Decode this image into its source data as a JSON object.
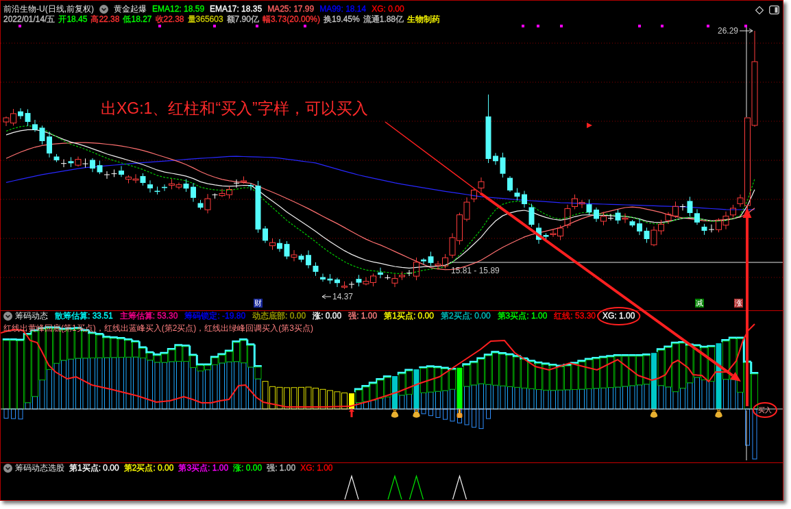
{
  "price_panel": {
    "title": "前沿生物-U(日线,前复权)",
    "formula": "黄金起爆",
    "indicators": [
      {
        "text": "EMA12: 18.59",
        "color": "#00ff00"
      },
      {
        "text": "EMA17: 18.35",
        "color": "#ffffff"
      },
      {
        "text": "MA25: 17.99",
        "color": "#ff6060"
      },
      {
        "text": "MA99: 18.14",
        "color": "#0000ff"
      },
      {
        "text": "XG: 0.00",
        "color": "#ff0000"
      }
    ],
    "quote": [
      {
        "text": "2022/01/14/五",
        "color": "#c0c0c0"
      },
      {
        "text": "开18.45",
        "color": "#00ff00"
      },
      {
        "text": "高22.38",
        "color": "#ff3232"
      },
      {
        "text": "低18.27",
        "color": "#00ff00"
      },
      {
        "text": "收22.38",
        "color": "#ff3232"
      },
      {
        "text": "量365603",
        "color": "#c8c800"
      },
      {
        "text": "额7.90亿",
        "color": "#c0c0c0"
      },
      {
        "text": "幅3.73(20.00%)",
        "color": "#ff3232"
      },
      {
        "text": "换19.45%",
        "color": "#c0c0c0"
      },
      {
        "text": "流通1.88亿",
        "color": "#c0c0c0"
      },
      {
        "text": "生物制药",
        "color": "#ffff00"
      }
    ],
    "high_label": "26.29",
    "range_label": "15.81 - 15.89",
    "low_label": "14.37",
    "event_markers": [
      {
        "text": "财",
        "color": "#1a2a9a"
      },
      {
        "text": "减",
        "color": "#008000"
      },
      {
        "text": "涨",
        "color": "#b03030"
      }
    ],
    "annotation": "出XG:1、红柱和“买入”字样，可以买入"
  },
  "chip_panel": {
    "title": "筹码动态",
    "values": [
      {
        "text": "散筹估算: 33.51",
        "color": "#00ffff"
      },
      {
        "text": "主筹估算: 53.30",
        "color": "#ff0090"
      },
      {
        "text": "筹码锁定: -19.80",
        "color": "#0000ff"
      },
      {
        "text": "动态底部: 0.00",
        "color": "#a0a000"
      },
      {
        "text": "涨: 0.00",
        "color": "#ffffff"
      },
      {
        "text": "强: 1.00",
        "color": "#ff8080"
      },
      {
        "text": "第1买点: 0.00",
        "color": "#ffff00"
      },
      {
        "text": "第2买点: 0.00",
        "color": "#00c0c0"
      },
      {
        "text": "第3买点: 1.00",
        "color": "#00ff00"
      },
      {
        "text": "红线: 53.30",
        "color": "#ff0000"
      },
      {
        "text": "XG: 1.00",
        "color": "#ffffff"
      }
    ],
    "legend": "红线出黄峰回底(第1买点)，红线出蓝峰买入(第2买点)，红线出绿峰回调买入(第3买点)",
    "buy_label": "买入"
  },
  "screener_panel": {
    "title": "筹码动态选股",
    "values": [
      {
        "text": "第1买点: 0.00",
        "color": "#ffffff"
      },
      {
        "text": "第2买点: 0.00",
        "color": "#ffff00"
      },
      {
        "text": "第3买点: 1.00",
        "color": "#ff00ff"
      },
      {
        "text": "涨: 0.00",
        "color": "#00ff00"
      },
      {
        "text": "强: 1.00",
        "color": "#c0c0c0"
      },
      {
        "text": "XG: 1.00",
        "color": "#ff0000"
      }
    ]
  }
}
